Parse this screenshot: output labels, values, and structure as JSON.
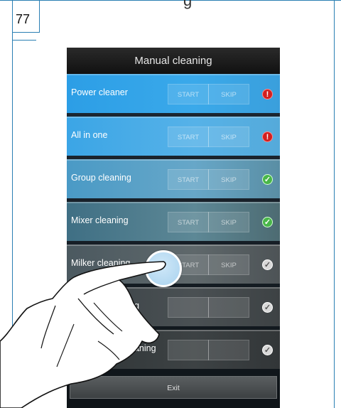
{
  "document": {
    "page_number": "77",
    "top_fragment": "g"
  },
  "app": {
    "title": "Manual cleaning",
    "exit_label": "Exit"
  },
  "rows": [
    {
      "label": "Power cleaner",
      "start": "START",
      "skip": "SKIP",
      "status": "warning"
    },
    {
      "label": "All in one",
      "start": "START",
      "skip": "SKIP",
      "status": "warning"
    },
    {
      "label": "Group cleaning",
      "start": "START",
      "skip": "SKIP",
      "status": "done"
    },
    {
      "label": "Mixer cleaning",
      "start": "START",
      "skip": "SKIP",
      "status": "done"
    },
    {
      "label": "Milker cleaning",
      "start": "START",
      "skip": "SKIP",
      "status": "pending"
    },
    {
      "label": "ng",
      "start": "",
      "skip": "",
      "status": "pending"
    },
    {
      "label": "eaning",
      "start": "",
      "skip": "",
      "status": "pending"
    }
  ],
  "colors": {
    "warning": "#d21f1f",
    "done": "#49b649",
    "pending": "#d8d8d8",
    "frame": "#2a7fb3"
  }
}
